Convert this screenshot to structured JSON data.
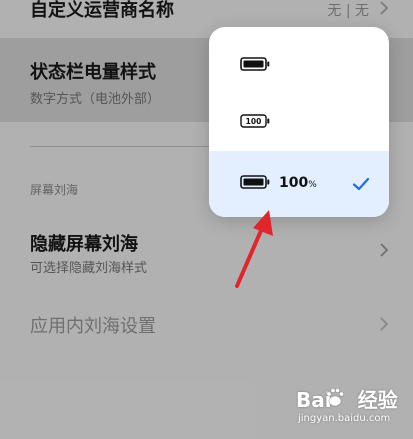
{
  "settings": {
    "carrier_name": {
      "title": "自定义运营商名称",
      "value": "无 | 无"
    },
    "battery_style": {
      "title": "状态栏电量样式",
      "subtitle": "数字方式（电池外部）"
    },
    "section_notch": "屏幕刘海",
    "hide_notch": {
      "title": "隐藏屏幕刘海",
      "subtitle": "可选择隐藏刘海样式"
    },
    "in_app_notch": {
      "title": "应用内刘海设置"
    }
  },
  "popup": {
    "options": [
      {
        "icon": "battery-icon",
        "label": ""
      },
      {
        "icon": "battery-number-icon",
        "label": "100"
      },
      {
        "icon": "battery-icon",
        "percent": "100",
        "percent_symbol": "%",
        "selected": true
      }
    ],
    "check_icon": "checkmark-icon",
    "selected_color": "#e3efff",
    "check_color": "#1e6fe6"
  },
  "annotation": {
    "icon": "red-arrow-icon",
    "color": "#e0262b"
  },
  "watermark": {
    "logo_left": "Bai",
    "logo_right": "经验",
    "url": "jingyan.baidu.com"
  }
}
